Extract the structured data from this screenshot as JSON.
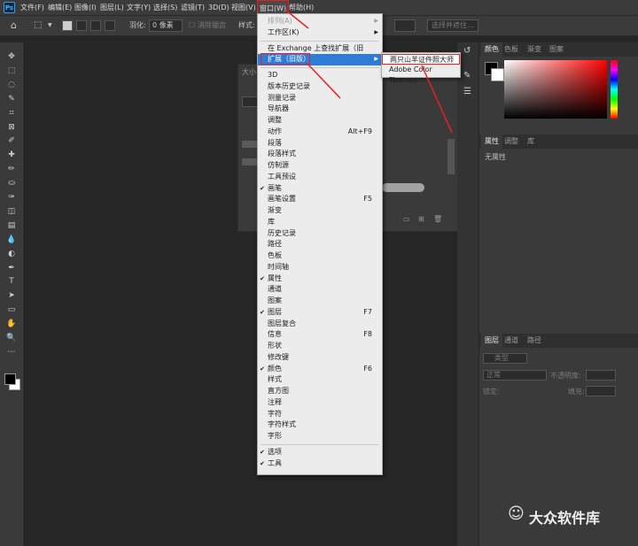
{
  "app": {
    "logo": "Ps"
  },
  "menubar": {
    "items": [
      "文件(F)",
      "编辑(E)",
      "图像(I)",
      "图层(L)",
      "文字(Y)",
      "选择(S)",
      "滤镜(T)",
      "3D(D)",
      "视图(V)",
      "窗口(W)",
      "帮助(H)"
    ]
  },
  "options_bar": {
    "feather_label": "羽化:",
    "feather_value": "0 像素",
    "antialias_label": "消除锯齿",
    "style_label": "样式:",
    "select_subject": "选择并遮住..."
  },
  "window_menu": {
    "items": [
      {
        "label": "排列(A)",
        "submenu": true,
        "disabled": true
      },
      {
        "label": "工作区(K)",
        "submenu": true
      },
      {
        "separator": true
      },
      {
        "label": "在 Exchange 上查找扩展（旧版）..."
      },
      {
        "label": "扩展（旧版）",
        "submenu": true,
        "highlighted": true
      },
      {
        "separator": true
      },
      {
        "label": "3D"
      },
      {
        "label": "版本历史记录"
      },
      {
        "label": "测量记录"
      },
      {
        "label": "导航器"
      },
      {
        "label": "调整"
      },
      {
        "label": "动作",
        "shortcut": "Alt+F9"
      },
      {
        "label": "段落"
      },
      {
        "label": "段落样式"
      },
      {
        "label": "仿制源"
      },
      {
        "label": "工具预设"
      },
      {
        "label": "画笔",
        "checked": true
      },
      {
        "label": "画笔设置",
        "shortcut": "F5"
      },
      {
        "label": "渐变"
      },
      {
        "label": "库"
      },
      {
        "label": "历史记录"
      },
      {
        "label": "路径"
      },
      {
        "label": "色板"
      },
      {
        "label": "时间轴"
      },
      {
        "label": "属性",
        "checked": true
      },
      {
        "label": "通道"
      },
      {
        "label": "图案"
      },
      {
        "label": "图层",
        "shortcut": "F7",
        "checked": true
      },
      {
        "label": "图层复合"
      },
      {
        "label": "信息",
        "shortcut": "F8"
      },
      {
        "label": "形状"
      },
      {
        "label": "修改键"
      },
      {
        "label": "颜色",
        "shortcut": "F6",
        "checked": true
      },
      {
        "label": "样式"
      },
      {
        "label": "直方图"
      },
      {
        "label": "注释"
      },
      {
        "label": "字符"
      },
      {
        "label": "字符样式"
      },
      {
        "label": "字形"
      },
      {
        "separator": true
      },
      {
        "label": "选项",
        "checked": true
      },
      {
        "label": "工具",
        "checked": true
      }
    ]
  },
  "extension_submenu": {
    "items": [
      "两只山羊证件照大师",
      "Adobe Color Themes"
    ]
  },
  "color_panel": {
    "tabs": [
      "颜色",
      "色板",
      "渐变",
      "图案"
    ]
  },
  "properties_panel": {
    "tabs": [
      "属性",
      "调整",
      "库"
    ],
    "empty_text": "无属性"
  },
  "layers_panel": {
    "tabs": [
      "图层",
      "通道",
      "路径"
    ],
    "filter_label": "类型",
    "blend_mode": "正常",
    "opacity_label": "不透明度:",
    "lock_label": "锁定:",
    "fill_label": "填充:"
  },
  "brush_panel": {
    "title": "大小"
  },
  "watermark": {
    "text": "大众软件库"
  },
  "tool_icons": [
    "move-icon",
    "marquee-icon",
    "lasso-icon",
    "quick-select-icon",
    "crop-icon",
    "frame-icon",
    "eyedropper-icon",
    "healing-icon",
    "brush-icon",
    "stamp-icon",
    "history-brush-icon",
    "eraser-icon",
    "gradient-icon",
    "blur-icon",
    "dodge-icon",
    "pen-icon",
    "type-icon",
    "path-select-icon",
    "shape-icon",
    "hand-icon",
    "zoom-icon",
    "more-icon"
  ],
  "tool_glyphs": [
    "✥",
    "⬚",
    "◌",
    "✎",
    "⌗",
    "⊠",
    "✐",
    "✚",
    "✏",
    "⛀",
    "✑",
    "◫",
    "▤",
    "💧",
    "◐",
    "✒",
    "T",
    "➤",
    "▭",
    "✋",
    "🔍",
    "⋯"
  ],
  "accent": {
    "highlight": "#2e7bd8",
    "annotation": "#e52222"
  }
}
